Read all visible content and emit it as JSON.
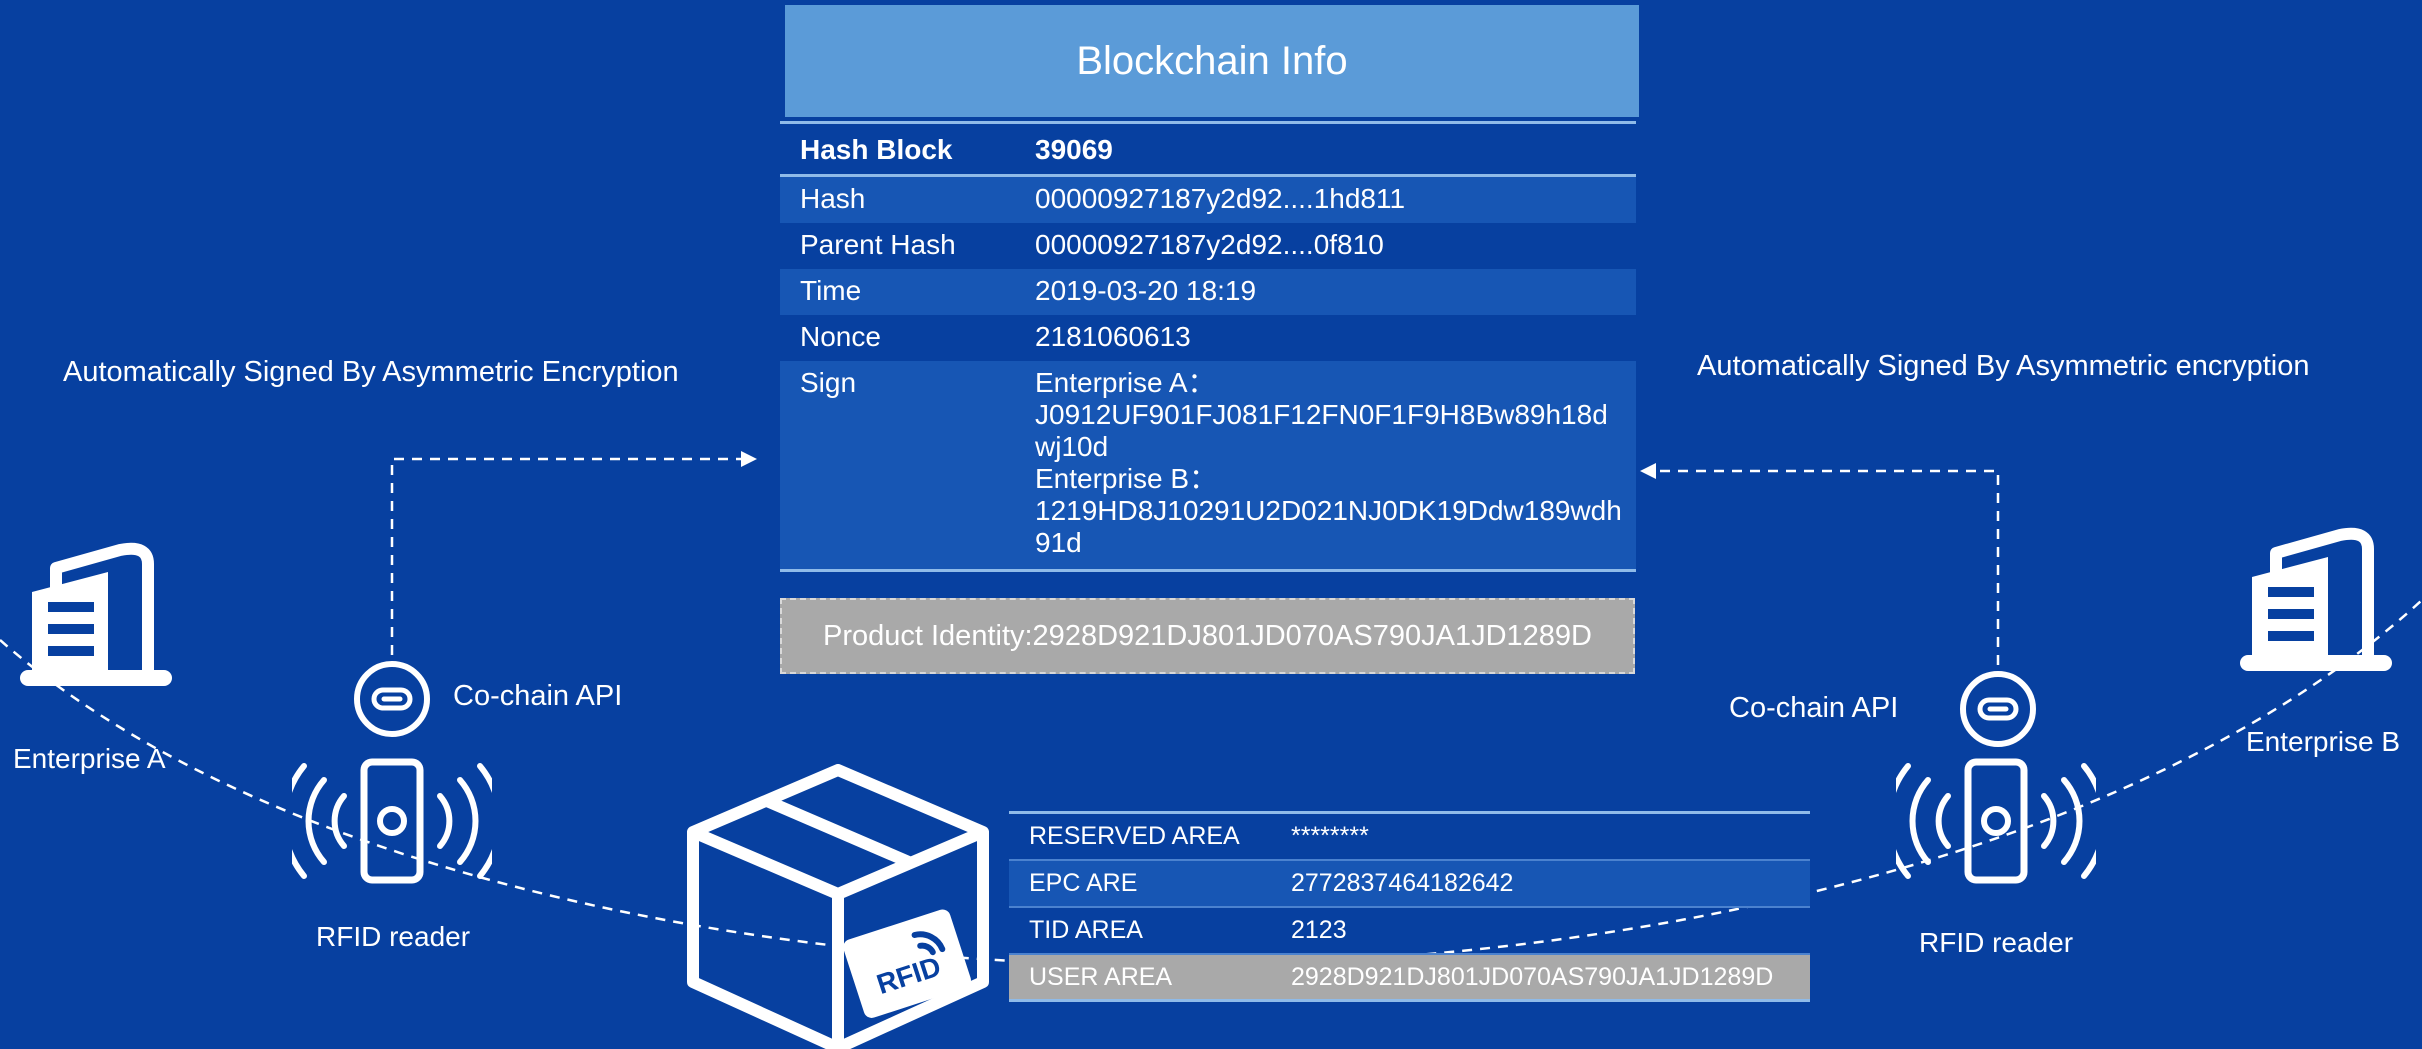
{
  "blockchain": {
    "title": "Blockchain Info",
    "rows": [
      {
        "key": "Hash Block",
        "value": "39069"
      },
      {
        "key": "Hash",
        "value": "00000927187y2d92....1hd811"
      },
      {
        "key": "Parent Hash",
        "value": "00000927187y2d92....0f810"
      },
      {
        "key": "Time",
        "value": "2019-03-20 18:19"
      },
      {
        "key": "Nonce",
        "value": "2181060613"
      }
    ],
    "sign": {
      "key": "Sign",
      "enterprise_a_label": "Enterprise A：",
      "enterprise_a_value": "J0912UF901FJ081F12FN0F1F9H8Bw89h18dwj10d",
      "enterprise_b_label": "Enterprise B：",
      "enterprise_b_value": "1219HD8J10291U2D021NJ0DK19Ddw189wdh91d"
    },
    "product_identity": "Product Identity:2928D921DJ801JD070AS790JA1JD1289D"
  },
  "left": {
    "signed_caption": "Automatically Signed By Asymmetric Encryption",
    "api_label": "Co-chain API",
    "reader_label": "RFID reader",
    "enterprise_label": "Enterprise A"
  },
  "right": {
    "signed_caption": "Automatically Signed By Asymmetric encryption",
    "api_label": "Co-chain API",
    "reader_label": "RFID reader",
    "enterprise_label": "Enterprise B"
  },
  "rfid_tag": {
    "badge_text": "RFID",
    "rows": [
      {
        "key": "RESERVED AREA",
        "value": "********"
      },
      {
        "key": "EPC ARE",
        "value": "2772837464182642"
      },
      {
        "key": "TID AREA",
        "value": "2123"
      },
      {
        "key": "USER AREA",
        "value": "2928D921DJ801JD070AS790JA1JD1289D"
      }
    ]
  },
  "colors": {
    "background": "#0740a0",
    "header": "#5b9bd8",
    "row_alt": "#1756b4",
    "highlight_grey": "#a9a9a9"
  }
}
